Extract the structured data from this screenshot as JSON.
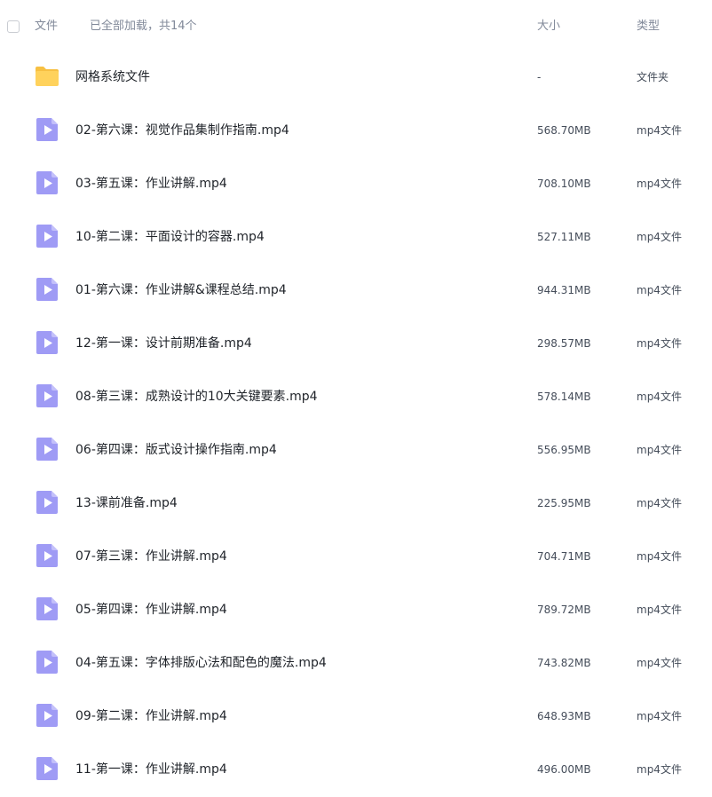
{
  "header": {
    "name_label": "文件",
    "status_text": "已全部加载，共14个",
    "size_label": "大小",
    "type_label": "类型"
  },
  "colors": {
    "folder": "#ffd25c",
    "video": "#9f9bf5",
    "muted_text": "#818999",
    "text": "#1f2329"
  },
  "files": [
    {
      "icon": "folder-icon",
      "name": "网格系统文件",
      "size": "-",
      "type": "文件夹"
    },
    {
      "icon": "video-file-icon",
      "name": "02-第六课：视觉作品集制作指南.mp4",
      "size": "568.70MB",
      "type": "mp4文件"
    },
    {
      "icon": "video-file-icon",
      "name": "03-第五课：作业讲解.mp4",
      "size": "708.10MB",
      "type": "mp4文件"
    },
    {
      "icon": "video-file-icon",
      "name": "10-第二课：平面设计的容器.mp4",
      "size": "527.11MB",
      "type": "mp4文件"
    },
    {
      "icon": "video-file-icon",
      "name": "01-第六课：作业讲解&课程总结.mp4",
      "size": "944.31MB",
      "type": "mp4文件"
    },
    {
      "icon": "video-file-icon",
      "name": "12-第一课：设计前期准备.mp4",
      "size": "298.57MB",
      "type": "mp4文件"
    },
    {
      "icon": "video-file-icon",
      "name": "08-第三课：成熟设计的10大关键要素.mp4",
      "size": "578.14MB",
      "type": "mp4文件"
    },
    {
      "icon": "video-file-icon",
      "name": "06-第四课：版式设计操作指南.mp4",
      "size": "556.95MB",
      "type": "mp4文件"
    },
    {
      "icon": "video-file-icon",
      "name": "13-课前准备.mp4",
      "size": "225.95MB",
      "type": "mp4文件"
    },
    {
      "icon": "video-file-icon",
      "name": "07-第三课：作业讲解.mp4",
      "size": "704.71MB",
      "type": "mp4文件"
    },
    {
      "icon": "video-file-icon",
      "name": "05-第四课：作业讲解.mp4",
      "size": "789.72MB",
      "type": "mp4文件"
    },
    {
      "icon": "video-file-icon",
      "name": "04-第五课：字体排版心法和配色的魔法.mp4",
      "size": "743.82MB",
      "type": "mp4文件"
    },
    {
      "icon": "video-file-icon",
      "name": "09-第二课：作业讲解.mp4",
      "size": "648.93MB",
      "type": "mp4文件"
    },
    {
      "icon": "video-file-icon",
      "name": "11-第一课：作业讲解.mp4",
      "size": "496.00MB",
      "type": "mp4文件"
    }
  ]
}
